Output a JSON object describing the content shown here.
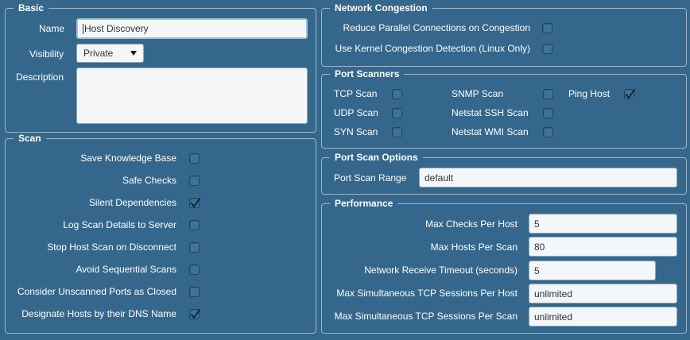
{
  "basic": {
    "title": "Basic",
    "name_label": "Name",
    "name_value": "Host Discovery",
    "visibility_label": "Visibility",
    "visibility_value": "Private",
    "description_label": "Description",
    "description_value": ""
  },
  "scan": {
    "title": "Scan",
    "items": [
      {
        "label": "Save Knowledge Base",
        "checked": false
      },
      {
        "label": "Safe Checks",
        "checked": false
      },
      {
        "label": "Silent Dependencies",
        "checked": true
      },
      {
        "label": "Log Scan Details to Server",
        "checked": false
      },
      {
        "label": "Stop Host Scan on Disconnect",
        "checked": false
      },
      {
        "label": "Avoid Sequential Scans",
        "checked": false
      },
      {
        "label": "Consider Unscanned Ports as Closed",
        "checked": false
      },
      {
        "label": "Designate Hosts by their DNS Name",
        "checked": true
      }
    ]
  },
  "congestion": {
    "title": "Network Congestion",
    "items": [
      {
        "label": "Reduce Parallel Connections on Congestion",
        "checked": false
      },
      {
        "label": "Use Kernel Congestion Detection (Linux Only)",
        "checked": false
      }
    ]
  },
  "scanners": {
    "title": "Port Scanners",
    "tcp": {
      "label": "TCP Scan",
      "checked": false
    },
    "udp": {
      "label": "UDP Scan",
      "checked": false
    },
    "syn": {
      "label": "SYN Scan",
      "checked": false
    },
    "snmp": {
      "label": "SNMP Scan",
      "checked": false
    },
    "ssh": {
      "label": "Netstat SSH Scan",
      "checked": false
    },
    "wmi": {
      "label": "Netstat WMI Scan",
      "checked": false
    },
    "ping": {
      "label": "Ping Host",
      "checked": true
    }
  },
  "port_options": {
    "title": "Port Scan Options",
    "range_label": "Port Scan Range",
    "range_value": "default"
  },
  "performance": {
    "title": "Performance",
    "max_checks_label": "Max Checks Per Host",
    "max_checks_value": "5",
    "max_hosts_label": "Max Hosts Per Scan",
    "max_hosts_value": "80",
    "timeout_label": "Network Receive Timeout (seconds)",
    "timeout_value": "5",
    "tcp_host_label": "Max Simultaneous TCP Sessions Per Host",
    "tcp_host_value": "unlimited",
    "tcp_scan_label": "Max Simultaneous TCP Sessions Per Scan",
    "tcp_scan_value": "unlimited"
  },
  "icons": {
    "check": "checkmark-icon",
    "dropdown": "chevron-down-icon"
  }
}
